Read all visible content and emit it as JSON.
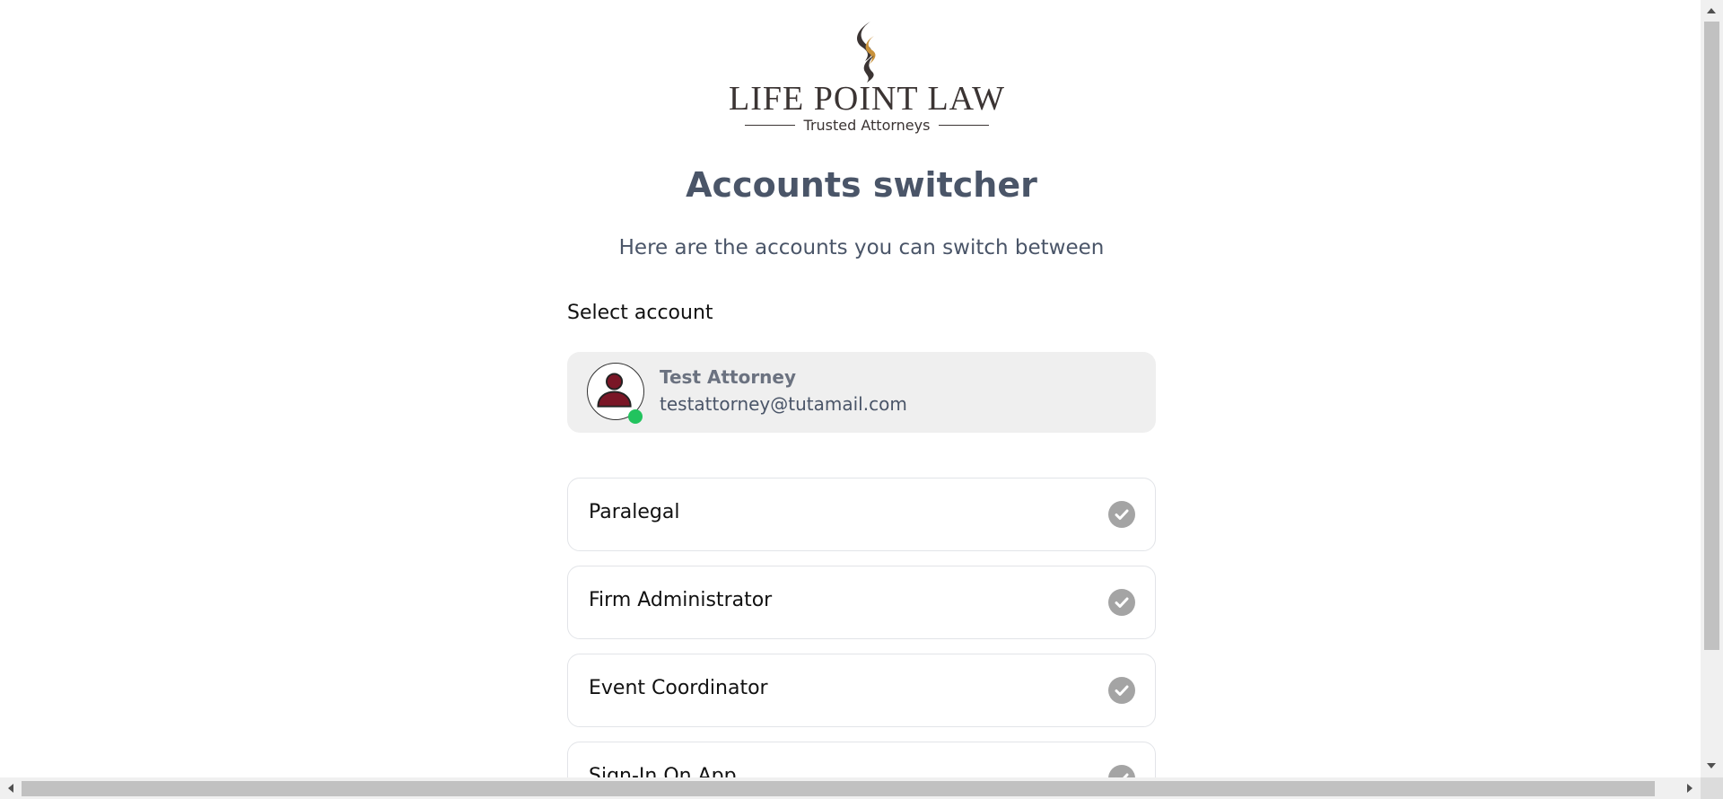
{
  "brand": {
    "name": "LIFE POINT LAW",
    "tagline": "Trusted Attorneys",
    "logo_icon": "flame-s-logo-icon",
    "colors": {
      "dark": "#3b3433",
      "gold": "#c8913a"
    }
  },
  "page": {
    "title": "Accounts switcher",
    "subtitle": "Here are the accounts you can switch between"
  },
  "select_label": "Select account",
  "current_account": {
    "name": "Test Attorney",
    "email": "testattorney@tutamail.com",
    "avatar_icon": "user-avatar-icon",
    "status": "online",
    "status_color": "#22c35e"
  },
  "roles": [
    {
      "label": "Paralegal",
      "icon": "check-circle-icon"
    },
    {
      "label": "Firm Administrator",
      "icon": "check-circle-icon"
    },
    {
      "label": "Event Coordinator",
      "icon": "check-circle-icon"
    },
    {
      "label": "Sign-In On App",
      "icon": "check-circle-icon"
    }
  ]
}
